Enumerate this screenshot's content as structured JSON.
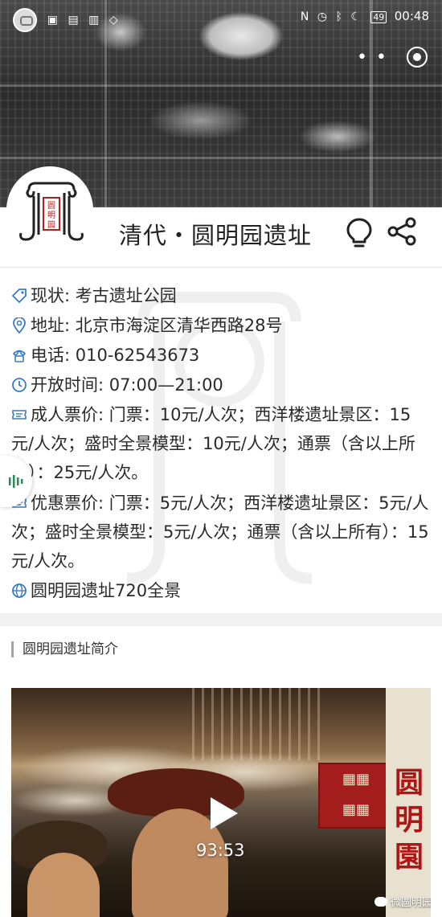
{
  "status_bar": {
    "battery": "49",
    "time": "00:48"
  },
  "header": {
    "title": "清代・圆明园遗址",
    "logo_text": "圆明园"
  },
  "info": {
    "status": "现状: 考古遗址公园",
    "address": "地址: 北京市海淀区清华西路28号",
    "phone": "电话: 010-62543673",
    "hours": "开放时间: 07:00—21:00",
    "adult_price": "成人票价: 门票：10元/人次；西洋楼遗址景区：15元/人次；盛时全景模型：10元/人次；通票（含以上所有）：25元/人次。",
    "discount_price": "优惠票价: 门票：5元/人次；西洋楼遗址景区：5元/人次；盛时全景模型：5元/人次；通票（含以上所有）：15元/人次。",
    "panorama_link": "圆明园遗址720全景"
  },
  "section": {
    "title": "圆明园遗址简介"
  },
  "video": {
    "duration": "93:53",
    "poster_title": "圆明園",
    "watermark": "微圆明园"
  },
  "icons": {
    "status": "tag-icon",
    "address": "location-pin-icon",
    "phone": "phone-icon",
    "hours": "clock-icon",
    "adult_price": "ticket-icon",
    "discount_price": "ticket-icon",
    "panorama": "globe-icon",
    "bulb": "lightbulb-icon",
    "share": "share-icon",
    "play": "play-icon"
  },
  "colors": {
    "icon_accent": "#3a7bbf",
    "section_bar": "#9aa7b3",
    "logo_dark": "#222222",
    "logo_red": "#b11e1e"
  }
}
